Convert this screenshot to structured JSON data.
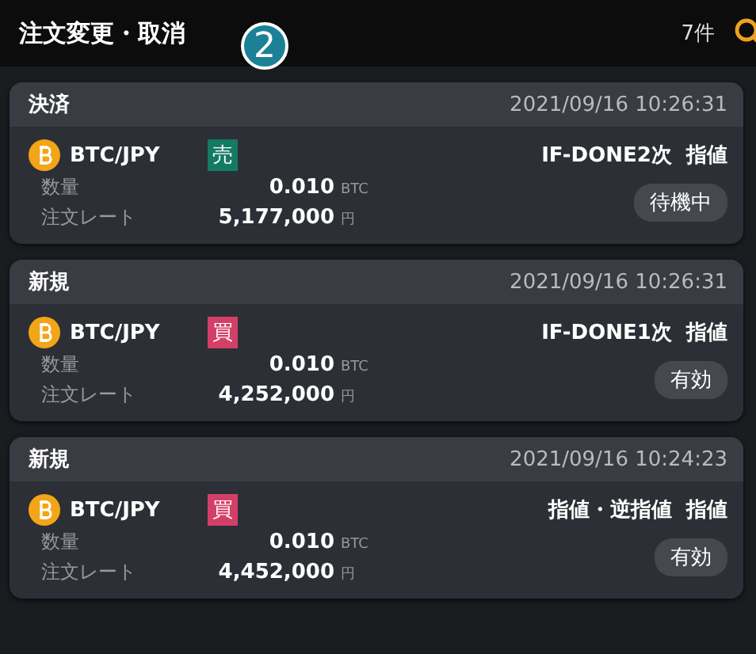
{
  "header": {
    "title": "注文変更・取消",
    "count": "7件"
  },
  "marker": "2",
  "orders": [
    {
      "type": "決済",
      "time": "2021/09/16 10:26:31",
      "pair": "BTC/JPY",
      "side": "売",
      "kind": "sell",
      "order_type": "IF-DONE2次  指値",
      "qty_label": "数量",
      "qty": "0.010",
      "qty_unit": "BTC",
      "rate_label": "注文レート",
      "rate": "5,177,000",
      "rate_unit": "円",
      "status": "待機中"
    },
    {
      "type": "新規",
      "time": "2021/09/16 10:26:31",
      "pair": "BTC/JPY",
      "side": "買",
      "kind": "buy",
      "order_type": "IF-DONE1次  指値",
      "qty_label": "数量",
      "qty": "0.010",
      "qty_unit": "BTC",
      "rate_label": "注文レート",
      "rate": "4,252,000",
      "rate_unit": "円",
      "status": "有効"
    },
    {
      "type": "新規",
      "time": "2021/09/16 10:24:23",
      "pair": "BTC/JPY",
      "side": "買",
      "kind": "buy",
      "order_type": "指値・逆指値  指値",
      "qty_label": "数量",
      "qty": "0.010",
      "qty_unit": "BTC",
      "rate_label": "注文レート",
      "rate": "4,452,000",
      "rate_unit": "円",
      "status": "有効"
    }
  ]
}
